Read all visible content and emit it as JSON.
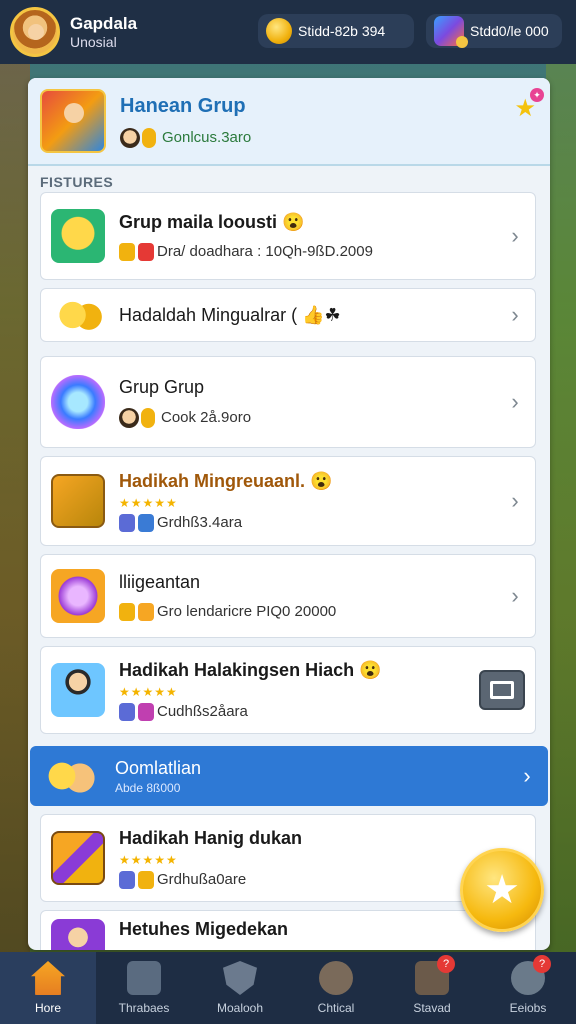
{
  "header": {
    "user_name": "Gapdala",
    "user_status": "Unosial",
    "coins": "Stidd-82b 394",
    "gems": "Stdd0/le 000"
  },
  "panel": {
    "title": "Hanean Grup",
    "subtitle": "Gonlcus.3aro",
    "section_label": "FISTURES"
  },
  "rows": [
    {
      "title": "Grup maila loousti 😮",
      "meta": "Dra/ doadhara : 10Qh-9ßD.2009"
    },
    {
      "title": "Hadaldah Mingualrar ( 👍☘"
    },
    {
      "title": "Grup Grup",
      "meta": "Cook 2å.9oro"
    },
    {
      "title": "Hadikah Mingreuaanl. 😮",
      "stars": "★★★★★",
      "meta": "Grdhß3.4ara"
    },
    {
      "title": "lliigeantan",
      "meta": "Gro lendaricre PIQ0 20000"
    },
    {
      "title": "Hadikah Halakingsen Hiach 😮",
      "stars": "★★★★★",
      "meta": "Cudhßs2åara"
    },
    {
      "title": "Oomlatlian",
      "meta": "Abde 8ß000"
    },
    {
      "title": "Hadikah Hanig dukan",
      "stars": "★★★★★",
      "meta": "Grdhußa0are"
    },
    {
      "title": "Hetuhes Migedekan"
    }
  ],
  "tabs": [
    {
      "label": "Hore",
      "icon": "home-icon"
    },
    {
      "label": "Thrabaes",
      "icon": "castle-icon"
    },
    {
      "label": "Moalooh",
      "icon": "shield-icon"
    },
    {
      "label": "Chtical",
      "icon": "profile-icon"
    },
    {
      "label": "Stavad",
      "icon": "store-icon",
      "badge": "?"
    },
    {
      "label": "Eeiobs",
      "icon": "world-icon",
      "badge": "?"
    }
  ],
  "colors": {
    "accent": "#2e79d5",
    "topbar": "#1f2f45",
    "star": "#f4b400"
  }
}
